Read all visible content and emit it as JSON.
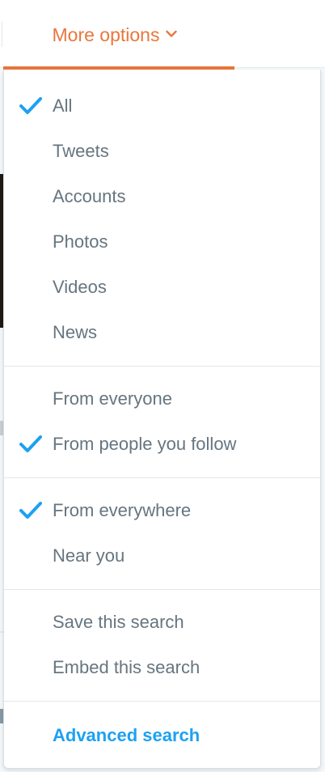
{
  "header": {
    "more_options_label": "More options"
  },
  "dropdown": {
    "groups": [
      {
        "items": [
          {
            "label": "All",
            "checked": true
          },
          {
            "label": "Tweets",
            "checked": false
          },
          {
            "label": "Accounts",
            "checked": false
          },
          {
            "label": "Photos",
            "checked": false
          },
          {
            "label": "Videos",
            "checked": false
          },
          {
            "label": "News",
            "checked": false
          }
        ]
      },
      {
        "items": [
          {
            "label": "From everyone",
            "checked": false
          },
          {
            "label": "From people you follow",
            "checked": true
          }
        ]
      },
      {
        "items": [
          {
            "label": "From everywhere",
            "checked": true
          },
          {
            "label": "Near you",
            "checked": false
          }
        ]
      },
      {
        "items": [
          {
            "label": "Save this search"
          },
          {
            "label": "Embed this search"
          }
        ]
      },
      {
        "items": [
          {
            "label": "Advanced search",
            "link": true
          }
        ]
      }
    ]
  },
  "colors": {
    "accent_orange": "#e8773d",
    "check_blue": "#1da1f2",
    "item_text": "#66757f",
    "divider": "#e1e8ed"
  },
  "icons": {
    "chevron": "chevron-down-icon",
    "check": "checkmark-icon"
  }
}
